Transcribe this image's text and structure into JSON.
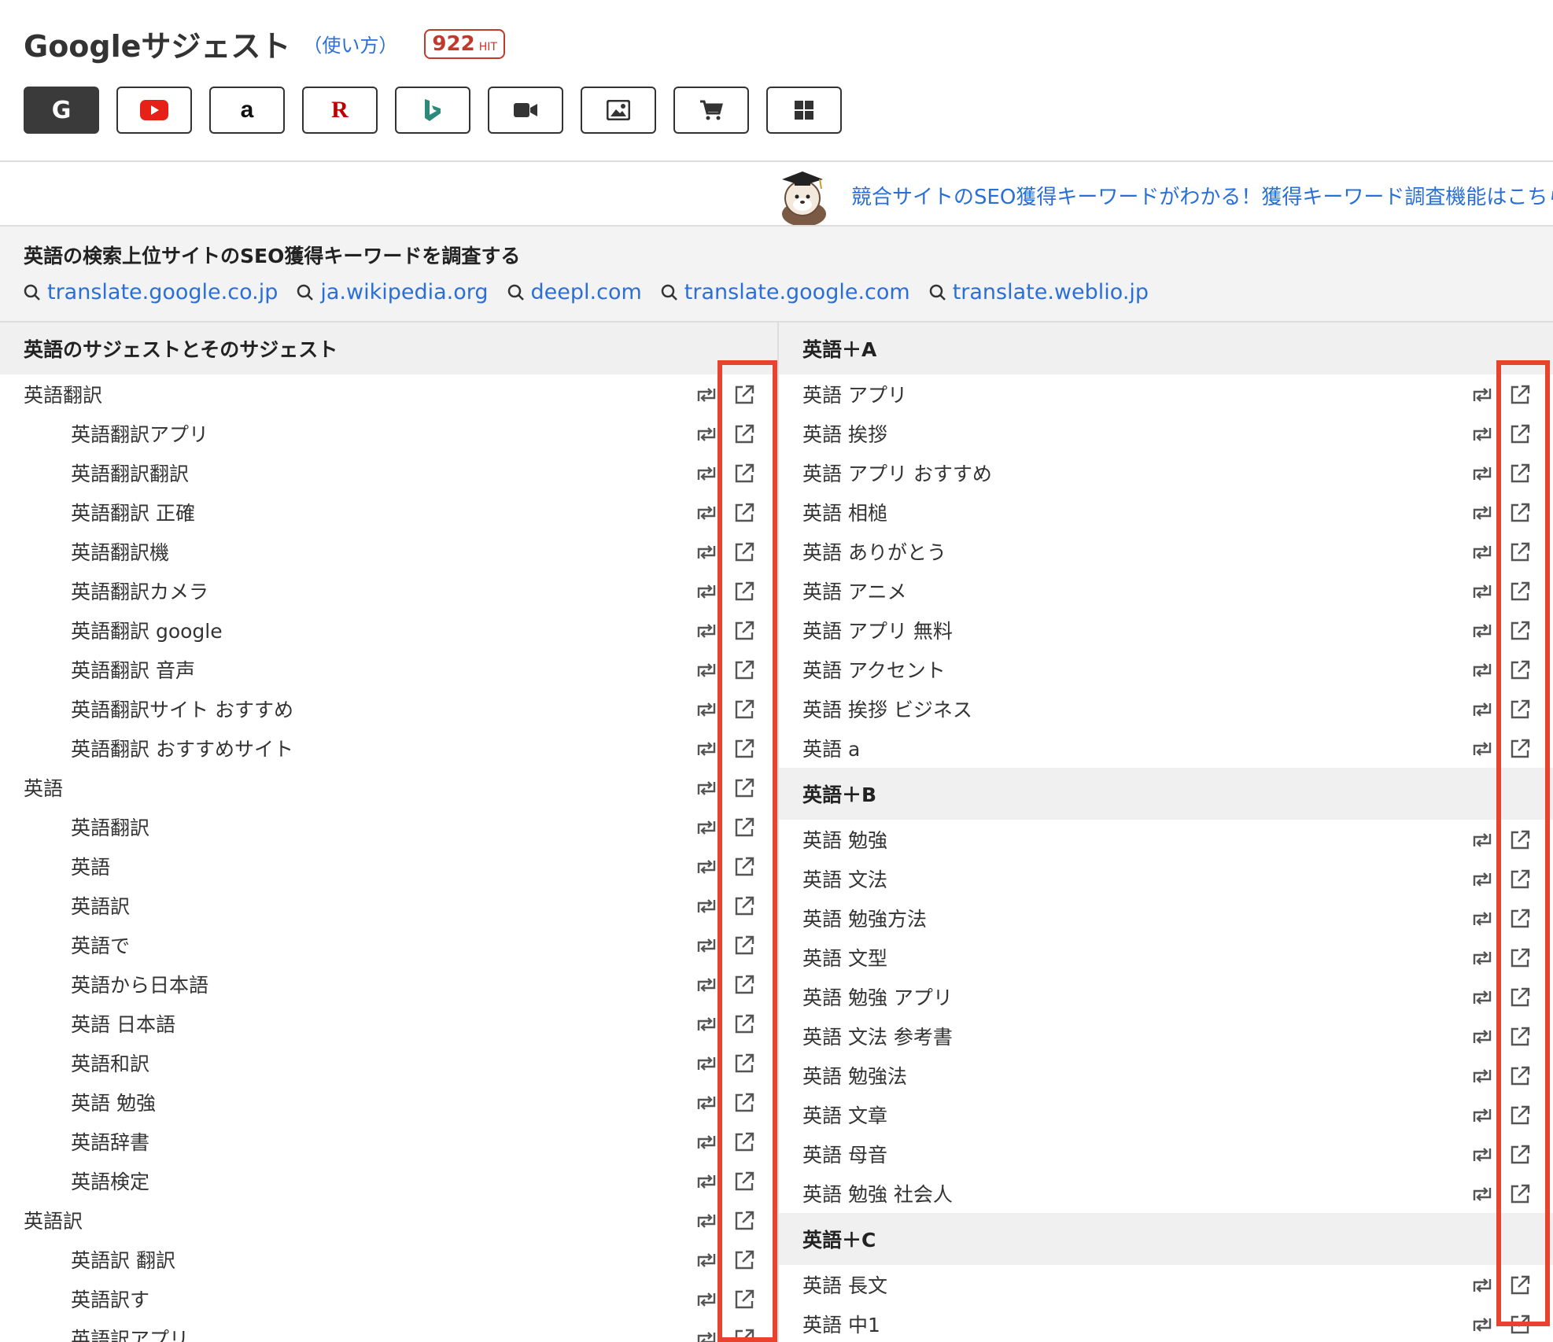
{
  "header": {
    "title": "Googleサジェスト",
    "howto": "（使い方）",
    "hit_count": "922",
    "hit_unit": "HIT",
    "engines": [
      {
        "name": "google",
        "glyph": "G",
        "active": true
      },
      {
        "name": "youtube",
        "glyph": "",
        "active": false
      },
      {
        "name": "amazon",
        "glyph": "a",
        "active": false
      },
      {
        "name": "rakuten",
        "glyph": "R",
        "active": false
      },
      {
        "name": "bing",
        "glyph": "",
        "active": false
      },
      {
        "name": "video",
        "glyph": "",
        "active": false
      },
      {
        "name": "image",
        "glyph": "",
        "active": false
      },
      {
        "name": "shopping",
        "glyph": "",
        "active": false
      },
      {
        "name": "apps",
        "glyph": "",
        "active": false
      }
    ]
  },
  "banner": {
    "text": "競合サイトのSEO獲得キーワードがわかる！獲得キーワード調査機能はこちら"
  },
  "seo": {
    "title": "英語の検索上位サイトのSEO獲得キーワードを調査する",
    "links": [
      "translate.google.co.jp",
      "ja.wikipedia.org",
      "deepl.com",
      "translate.google.com",
      "translate.weblio.jp"
    ]
  },
  "left_column": {
    "heading": "英語のサジェストとそのサジェスト",
    "rows": [
      {
        "text": "英語翻訳",
        "level": 0
      },
      {
        "text": "英語翻訳アプリ",
        "level": 1
      },
      {
        "text": "英語翻訳翻訳",
        "level": 1
      },
      {
        "text": "英語翻訳 正確",
        "level": 1
      },
      {
        "text": "英語翻訳機",
        "level": 1
      },
      {
        "text": "英語翻訳カメラ",
        "level": 1
      },
      {
        "text": "英語翻訳 google",
        "level": 1
      },
      {
        "text": "英語翻訳 音声",
        "level": 1
      },
      {
        "text": "英語翻訳サイト おすすめ",
        "level": 1
      },
      {
        "text": "英語翻訳 おすすめサイト",
        "level": 1
      },
      {
        "text": "英語",
        "level": 0
      },
      {
        "text": "英語翻訳",
        "level": 1
      },
      {
        "text": "英語",
        "level": 1
      },
      {
        "text": "英語訳",
        "level": 1
      },
      {
        "text": "英語で",
        "level": 1
      },
      {
        "text": "英語から日本語",
        "level": 1
      },
      {
        "text": "英語 日本語",
        "level": 1
      },
      {
        "text": "英語和訳",
        "level": 1
      },
      {
        "text": "英語 勉強",
        "level": 1
      },
      {
        "text": "英語辞書",
        "level": 1
      },
      {
        "text": "英語検定",
        "level": 1
      },
      {
        "text": "英語訳",
        "level": 0
      },
      {
        "text": "英語訳 翻訳",
        "level": 1
      },
      {
        "text": "英語訳す",
        "level": 1
      },
      {
        "text": "英語訳アプリ",
        "level": 1
      }
    ]
  },
  "right_column": {
    "sections": [
      {
        "heading": "英語＋A",
        "rows": [
          "英語 アプリ",
          "英語 挨拶",
          "英語 アプリ おすすめ",
          "英語 相槌",
          "英語 ありがとう",
          "英語 アニメ",
          "英語 アプリ 無料",
          "英語 アクセント",
          "英語 挨拶 ビジネス",
          "英語 a"
        ]
      },
      {
        "heading": "英語＋B",
        "rows": [
          "英語 勉強",
          "英語 文法",
          "英語 勉強方法",
          "英語 文型",
          "英語 勉強 アプリ",
          "英語 文法 参考書",
          "英語 勉強法",
          "英語 文章",
          "英語 母音",
          "英語 勉強 社会人"
        ]
      },
      {
        "heading": "英語＋C",
        "rows": [
          "英語 長文",
          "英語 中1"
        ]
      }
    ]
  },
  "colors": {
    "accent_link": "#2a6fd6",
    "hit_red": "#c0392b",
    "highlight_box": "#e8432f",
    "active_engine_bg": "#3a3a3a"
  }
}
